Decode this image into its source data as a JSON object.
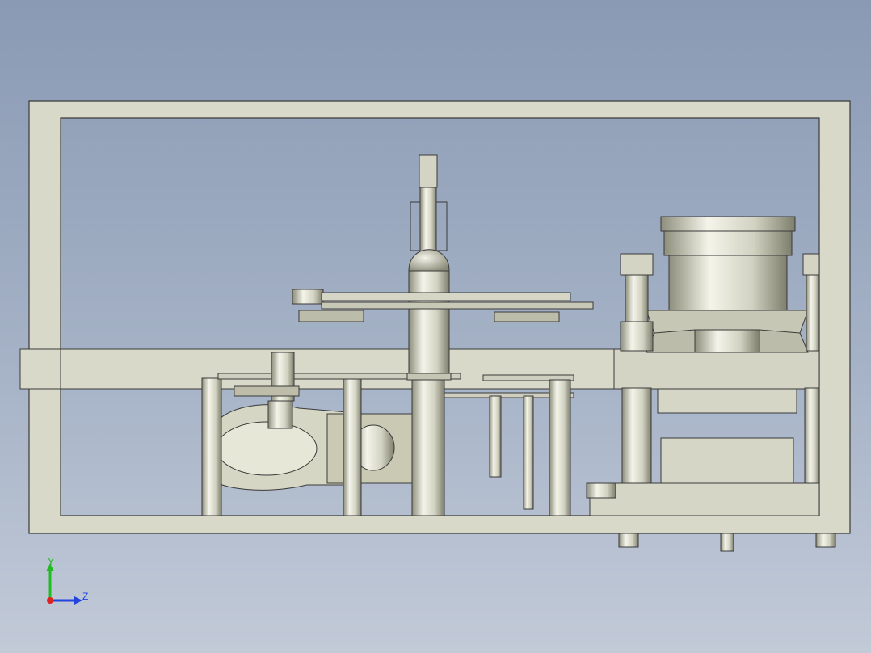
{
  "viewport": {
    "background_top": "#8a9ab4",
    "background_bottom": "#c2cad8",
    "model_fill": "#dcdccc",
    "model_edge": "#3a3a3a",
    "metal_light": "#f2f2e6",
    "metal_dark": "#9a9a88"
  },
  "triad": {
    "y_label": "Y",
    "z_label": "Z",
    "y_color": "#22bb22",
    "z_color": "#2244dd",
    "x_color": "#dd2222"
  }
}
